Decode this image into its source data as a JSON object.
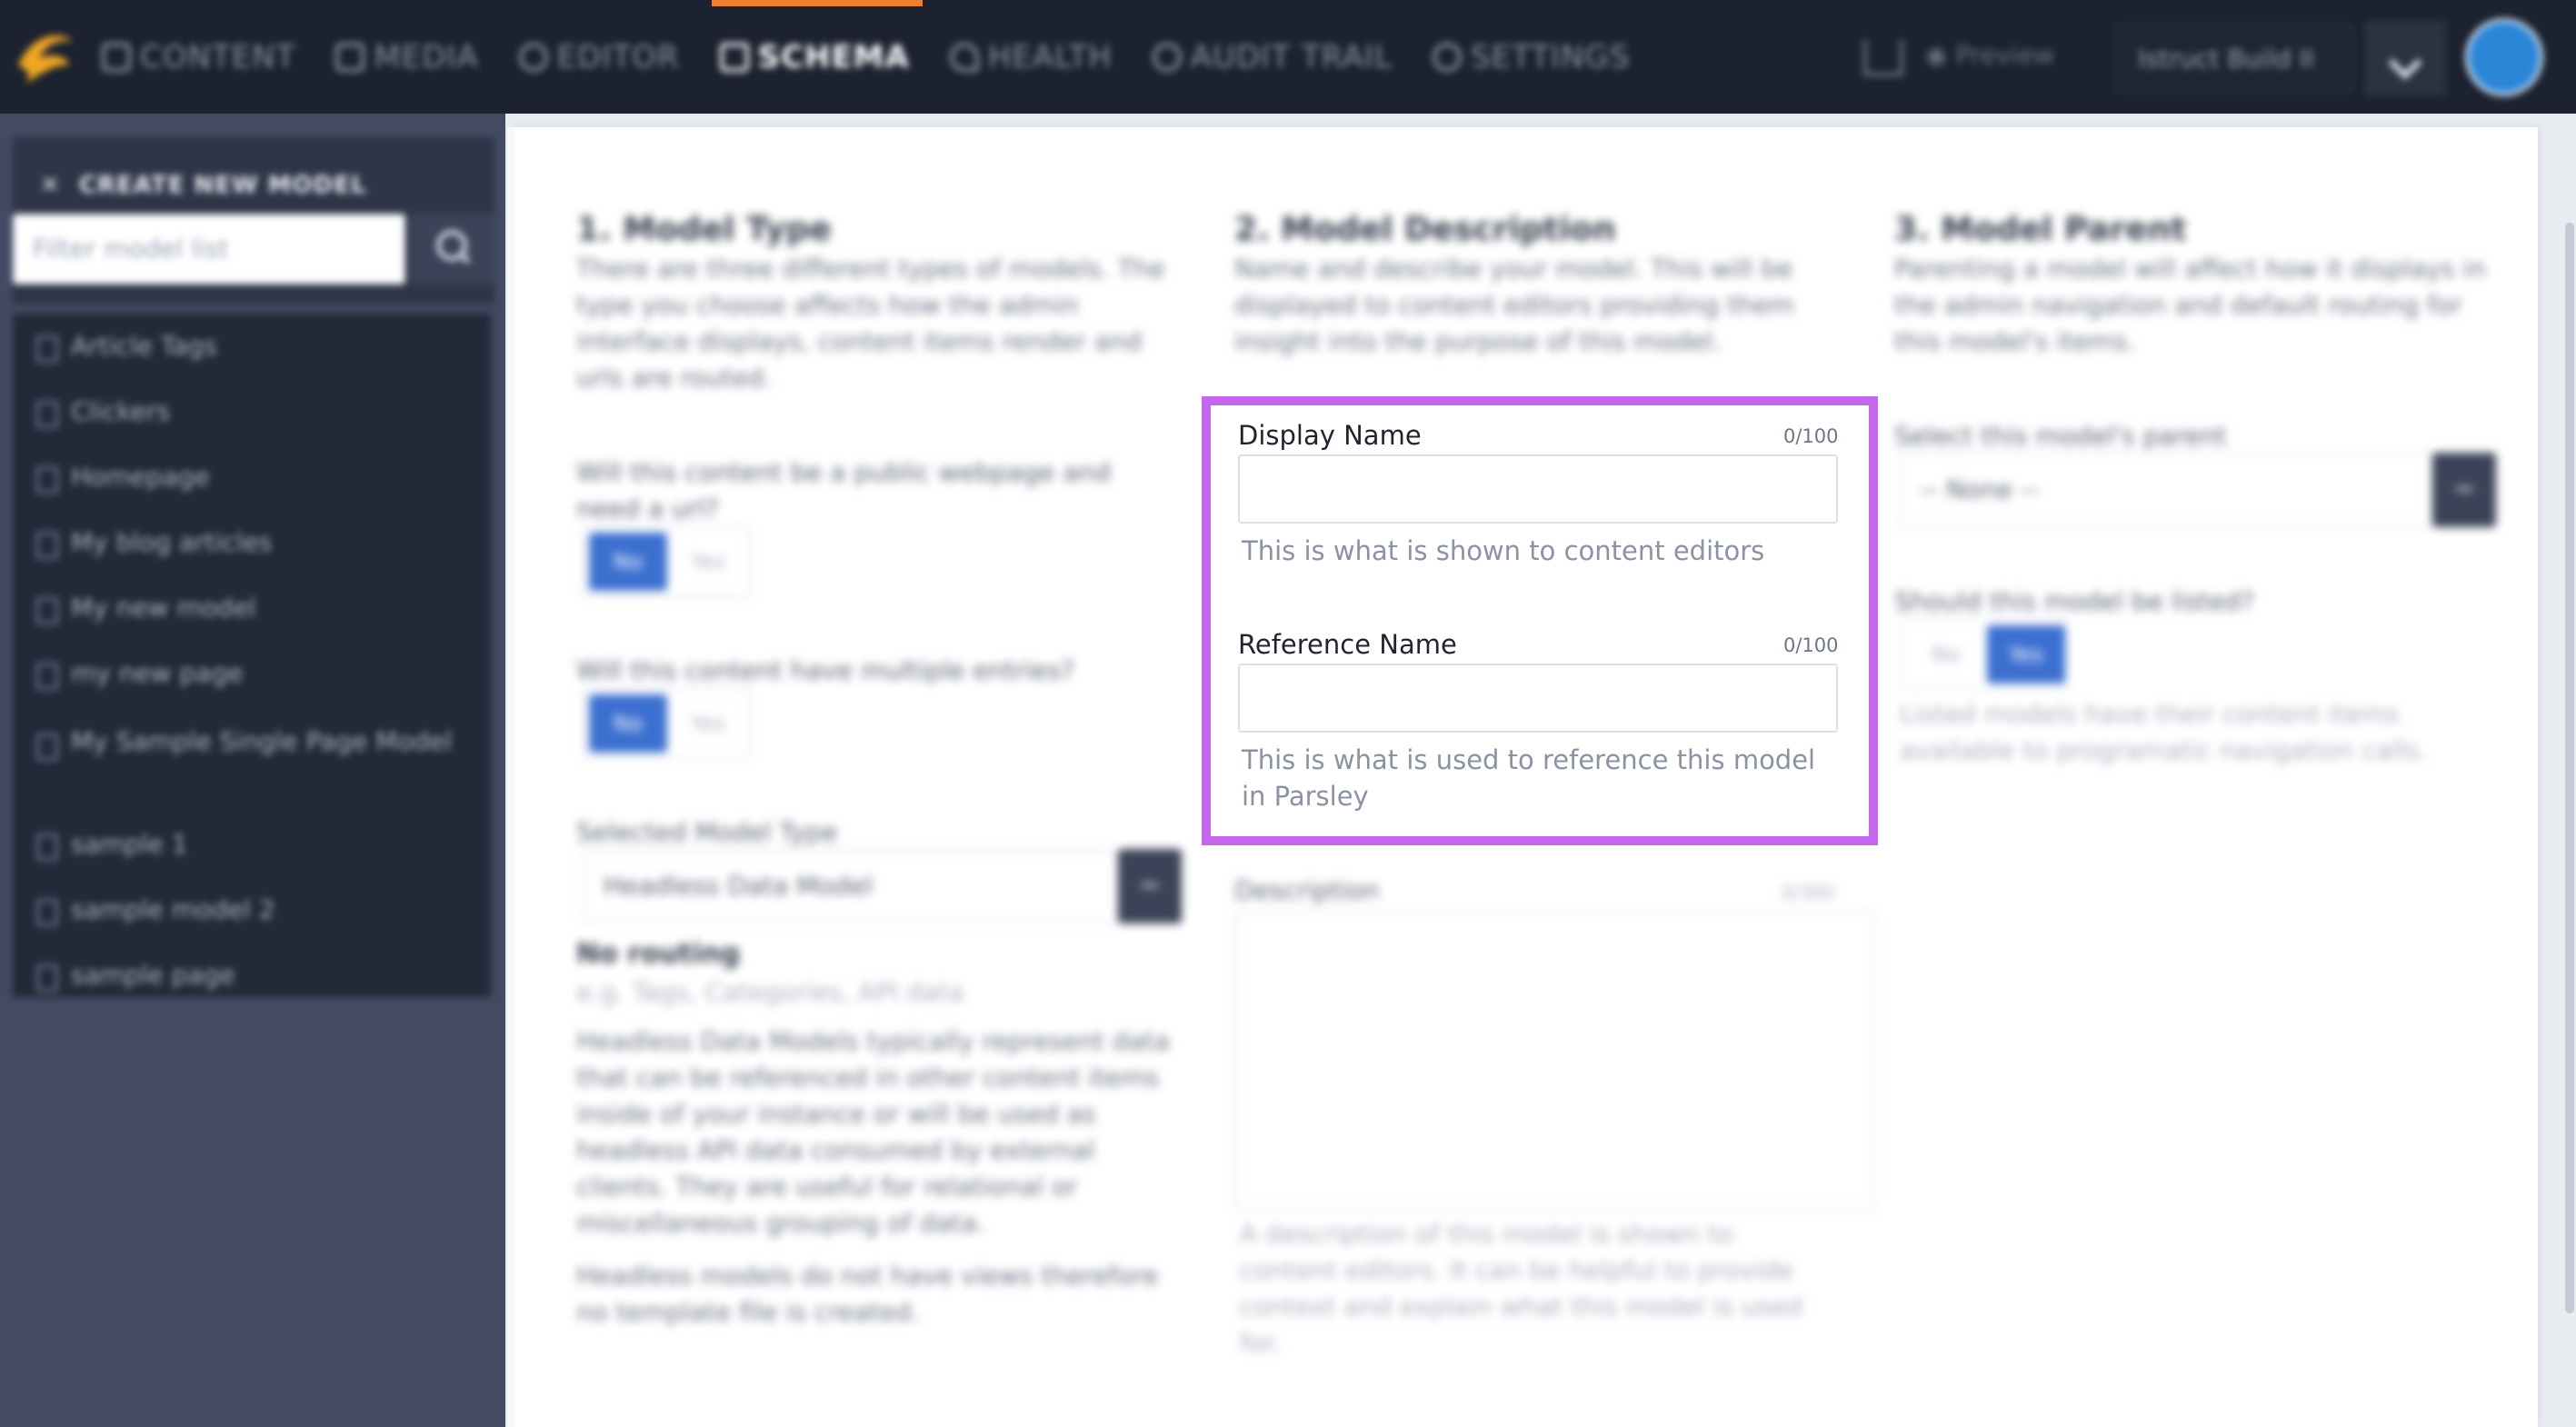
{
  "nav": {
    "items": [
      {
        "label": "CONTENT",
        "icon": "edit-icon"
      },
      {
        "label": "MEDIA",
        "icon": "image-icon"
      },
      {
        "label": "EDITOR",
        "icon": "code-icon"
      },
      {
        "label": "SCHEMA",
        "icon": "database-icon"
      },
      {
        "label": "HEALTH",
        "icon": "heart-icon"
      },
      {
        "label": "AUDIT TRAIL",
        "icon": "user-icon"
      },
      {
        "label": "SETTINGS",
        "icon": "gear-icon"
      }
    ],
    "active_index": 3,
    "accent_color": "#f0802f",
    "preview_label": "Preview",
    "instance_label": "Istruct Build II"
  },
  "sidebar": {
    "create_label": "CREATE NEW MODEL",
    "filter_placeholder": "Filter model list",
    "models": [
      "Article Tags",
      "Clickers",
      "Homepage",
      "My blog articles",
      "My new model",
      "my new page",
      "My Sample Single Page Model",
      "sample 1",
      "sample model 2",
      "sample page"
    ]
  },
  "model_type": {
    "title": "1. Model Type",
    "description": "There are three different types of models. The type you choose affects how the admin interface displays, content items render and urls are routed.",
    "q_public": "Will this content be a public webpage and need a url?",
    "q_multiple": "Will this content have multiple entries?",
    "no_label": "No",
    "yes_label": "Yes",
    "selected_label": "Selected Model Type",
    "selected_value": "Headless Data Model",
    "routing_title": "No routing",
    "routing_example": "e.g. Tags, Categories, API data",
    "routing_desc": "Headless Data Models typically represent data that can be referenced in other content items inside of your instance or will be used as headless API data consumed by external clients. They are useful for relational or miscellaneous grouping of data.",
    "routing_note": "Headless models do not have views therefore no template file is created."
  },
  "model_description": {
    "title": "2. Model Description",
    "description": "Name and describe your model. This will be displayed to content editors providing them insight into the purpose of this model.",
    "display_name_label": "Display Name",
    "display_name_count": "0/100",
    "display_name_value": "",
    "display_name_help": "This is what is shown to content editors",
    "reference_name_label": "Reference Name",
    "reference_name_count": "0/100",
    "reference_name_value": "",
    "reference_name_help": "This is what is used to reference this model in Parsley",
    "description_label": "Description",
    "description_count": "0/300",
    "description_help": "A description of this model is shown to content editors. It can be helpful to provide context and explain what this model is used for.",
    "highlight_color": "#c566ee"
  },
  "model_parent": {
    "title": "3. Model Parent",
    "description": "Parenting a model will affect how it displays in the admin navigation and default routing for this model's items.",
    "select_label": "Select this model's parent",
    "select_value": "-- None --",
    "q_listed": "Should this model be listed?",
    "no_label": "No",
    "yes_label": "Yes",
    "listed_help": "Listed models have their content items available to programatic navigation calls."
  }
}
